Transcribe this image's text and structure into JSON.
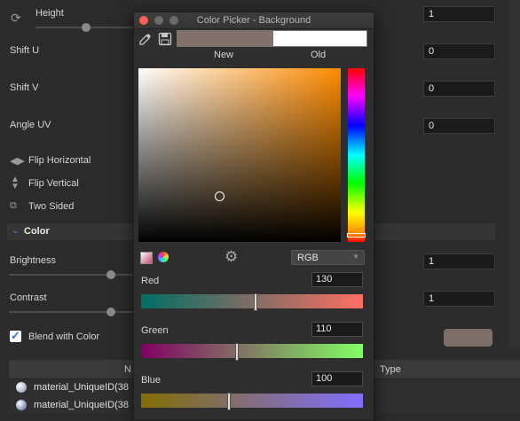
{
  "props": {
    "height_label": "Height",
    "height_value": "1",
    "shift_u_label": "Shift U",
    "shift_u_value": "0",
    "shift_v_label": "Shift V",
    "shift_v_value": "0",
    "angle_uv_label": "Angle UV",
    "angle_uv_value": "0",
    "flip_h_label": "Flip Horizontal",
    "flip_v_label": "Flip Vertical",
    "two_sided_label": "Two Sided",
    "color_section_label": "Color",
    "brightness_label": "Brightness",
    "brightness_value": "1",
    "contrast_label": "Contrast",
    "contrast_value": "1",
    "blend_label": "Blend with Color",
    "blend_checked": true,
    "blend_color": "#7e6e68"
  },
  "table": {
    "col_name": "N",
    "col_type": "Type",
    "rows": [
      "material_UniqueID(38",
      "material_UniqueID(38"
    ]
  },
  "picker": {
    "title": "Color Picker - Background",
    "new_label": "New",
    "old_label": "Old",
    "new_color": "#82706a",
    "old_color": "#ffffff",
    "mode": "RGB",
    "red_label": "Red",
    "red_value": "130",
    "green_label": "Green",
    "green_value": "110",
    "blue_label": "Blue",
    "blue_value": "100"
  }
}
